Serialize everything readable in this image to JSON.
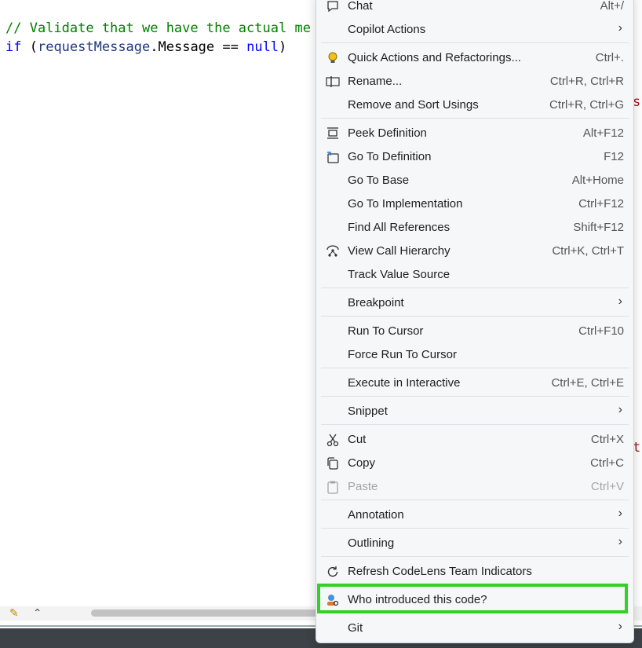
{
  "editor": {
    "line_comment": "// Validate that we have the actual me",
    "line_if_kw": "if",
    "line_if_rest_1": " (",
    "line_if_name": "requestMessage",
    "line_if_rest_2": ".Message == ",
    "line_if_null": "null",
    "line_if_rest_3": ")",
    "right_fragment_1": "s",
    "right_fragment_2": "t"
  },
  "menu": {
    "items": [
      {
        "label": "Chat",
        "shortcut": "Alt+/",
        "icon": "chat-icon"
      },
      {
        "label": "Copilot Actions",
        "chevron": "›"
      },
      {
        "label": "Quick Actions and Refactorings...",
        "shortcut": "Ctrl+.",
        "icon": "lightbulb-icon"
      },
      {
        "label": "Rename...",
        "shortcut": "Ctrl+R, Ctrl+R",
        "icon": "rename-icon"
      },
      {
        "label": "Remove and Sort Usings",
        "shortcut": "Ctrl+R, Ctrl+G"
      },
      {
        "label": "Peek Definition",
        "shortcut": "Alt+F12",
        "icon": "peek-definition-icon"
      },
      {
        "label": "Go To Definition",
        "shortcut": "F12",
        "icon": "go-to-definition-icon"
      },
      {
        "label": "Go To Base",
        "shortcut": "Alt+Home"
      },
      {
        "label": "Go To Implementation",
        "shortcut": "Ctrl+F12"
      },
      {
        "label": "Find All References",
        "shortcut": "Shift+F12"
      },
      {
        "label": "View Call Hierarchy",
        "shortcut": "Ctrl+K, Ctrl+T",
        "icon": "call-hierarchy-icon"
      },
      {
        "label": "Track Value Source"
      },
      {
        "label": "Breakpoint",
        "chevron": "›"
      },
      {
        "label": "Run To Cursor",
        "shortcut": "Ctrl+F10"
      },
      {
        "label": "Force Run To Cursor"
      },
      {
        "label": "Execute in Interactive",
        "shortcut": "Ctrl+E, Ctrl+E"
      },
      {
        "label": "Snippet",
        "chevron": "›"
      },
      {
        "label": "Cut",
        "shortcut": "Ctrl+X",
        "icon": "scissors-icon"
      },
      {
        "label": "Copy",
        "shortcut": "Ctrl+C",
        "icon": "copy-icon"
      },
      {
        "label": "Paste",
        "shortcut": "Ctrl+V",
        "icon": "paste-icon",
        "disabled": true
      },
      {
        "label": "Annotation",
        "chevron": "›"
      },
      {
        "label": "Outlining",
        "chevron": "›"
      },
      {
        "label": "Refresh CodeLens Team Indicators",
        "icon": "refresh-icon"
      },
      {
        "label": "Who introduced this code?",
        "icon": "user-search-icon",
        "highlighted": true
      },
      {
        "label": "Git",
        "chevron": "›"
      }
    ]
  },
  "colors": {
    "highlight_border": "#33d126",
    "comment": "#008000",
    "keyword": "#0000ff"
  }
}
